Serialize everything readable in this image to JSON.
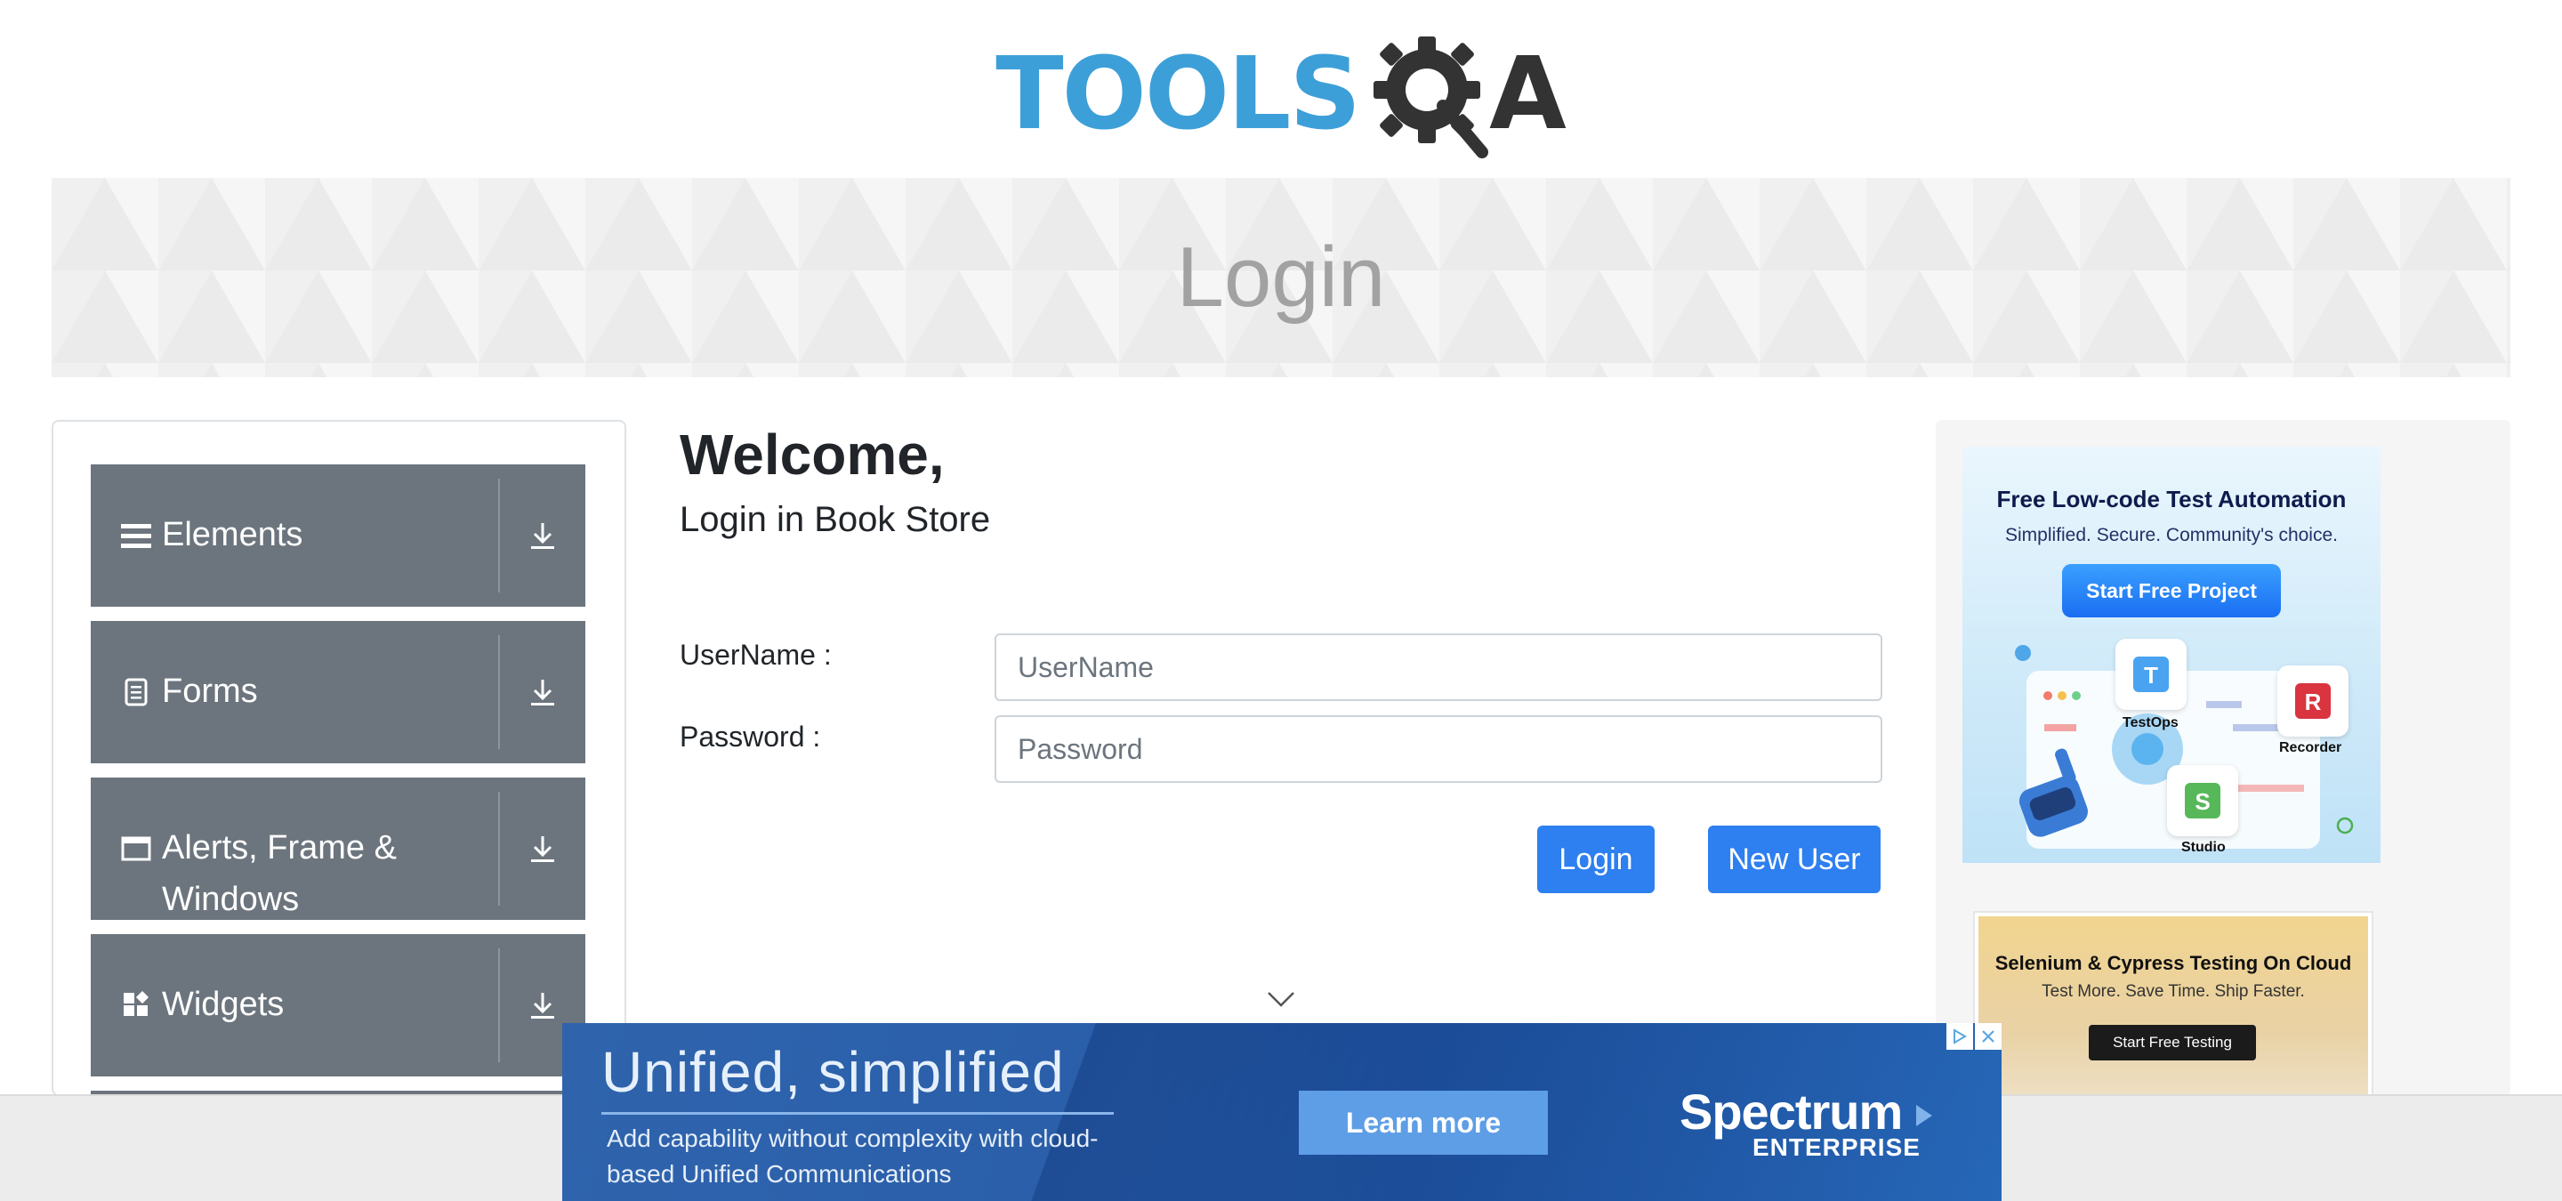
{
  "header": {
    "logo_text_blue": "TOOLS",
    "logo_text_dark": "A",
    "logo_icon": "gear-magnifier-icon"
  },
  "banner": {
    "title": "Login"
  },
  "sidebar": {
    "groups": [
      {
        "label": "Elements",
        "icon": "hamburger-icon"
      },
      {
        "label": "Forms",
        "icon": "document-icon"
      },
      {
        "label": "Alerts, Frame & Windows",
        "line1": "Alerts, Frame &",
        "line2": "Windows",
        "icon": "window-icon"
      },
      {
        "label": "Widgets",
        "icon": "widgets-icon"
      }
    ]
  },
  "main": {
    "welcome": "Welcome,",
    "subtitle": "Login in Book Store",
    "username_label": "UserName :",
    "username_placeholder": "UserName",
    "username_value": "",
    "password_label": "Password :",
    "password_placeholder": "Password",
    "password_value": "",
    "login_button": "Login",
    "new_user_button": "New User"
  },
  "ads": {
    "katalon": {
      "title": "Free Low-code Test Automation",
      "subtitle": "Simplified. Secure. Community's choice.",
      "button": "Start Free Project",
      "tile1": "TestOps",
      "tile2": "Recorder",
      "tile3": "Studio"
    },
    "cloud": {
      "title": "Selenium & Cypress Testing On Cloud",
      "subtitle": "Test More. Save Time. Ship Faster.",
      "button": "Start Free Testing"
    },
    "bottom": {
      "headline": "Unified, simplified",
      "body": "Add capability without complexity with cloud-based Unified Communications",
      "button": "Learn more",
      "brand": "Spectrum",
      "brand_sub": "ENTERPRISE"
    }
  },
  "colors": {
    "primary_button": "#2e7ff0",
    "sidebar_group": "#6c757d",
    "logo_blue": "#3d9fd8"
  }
}
